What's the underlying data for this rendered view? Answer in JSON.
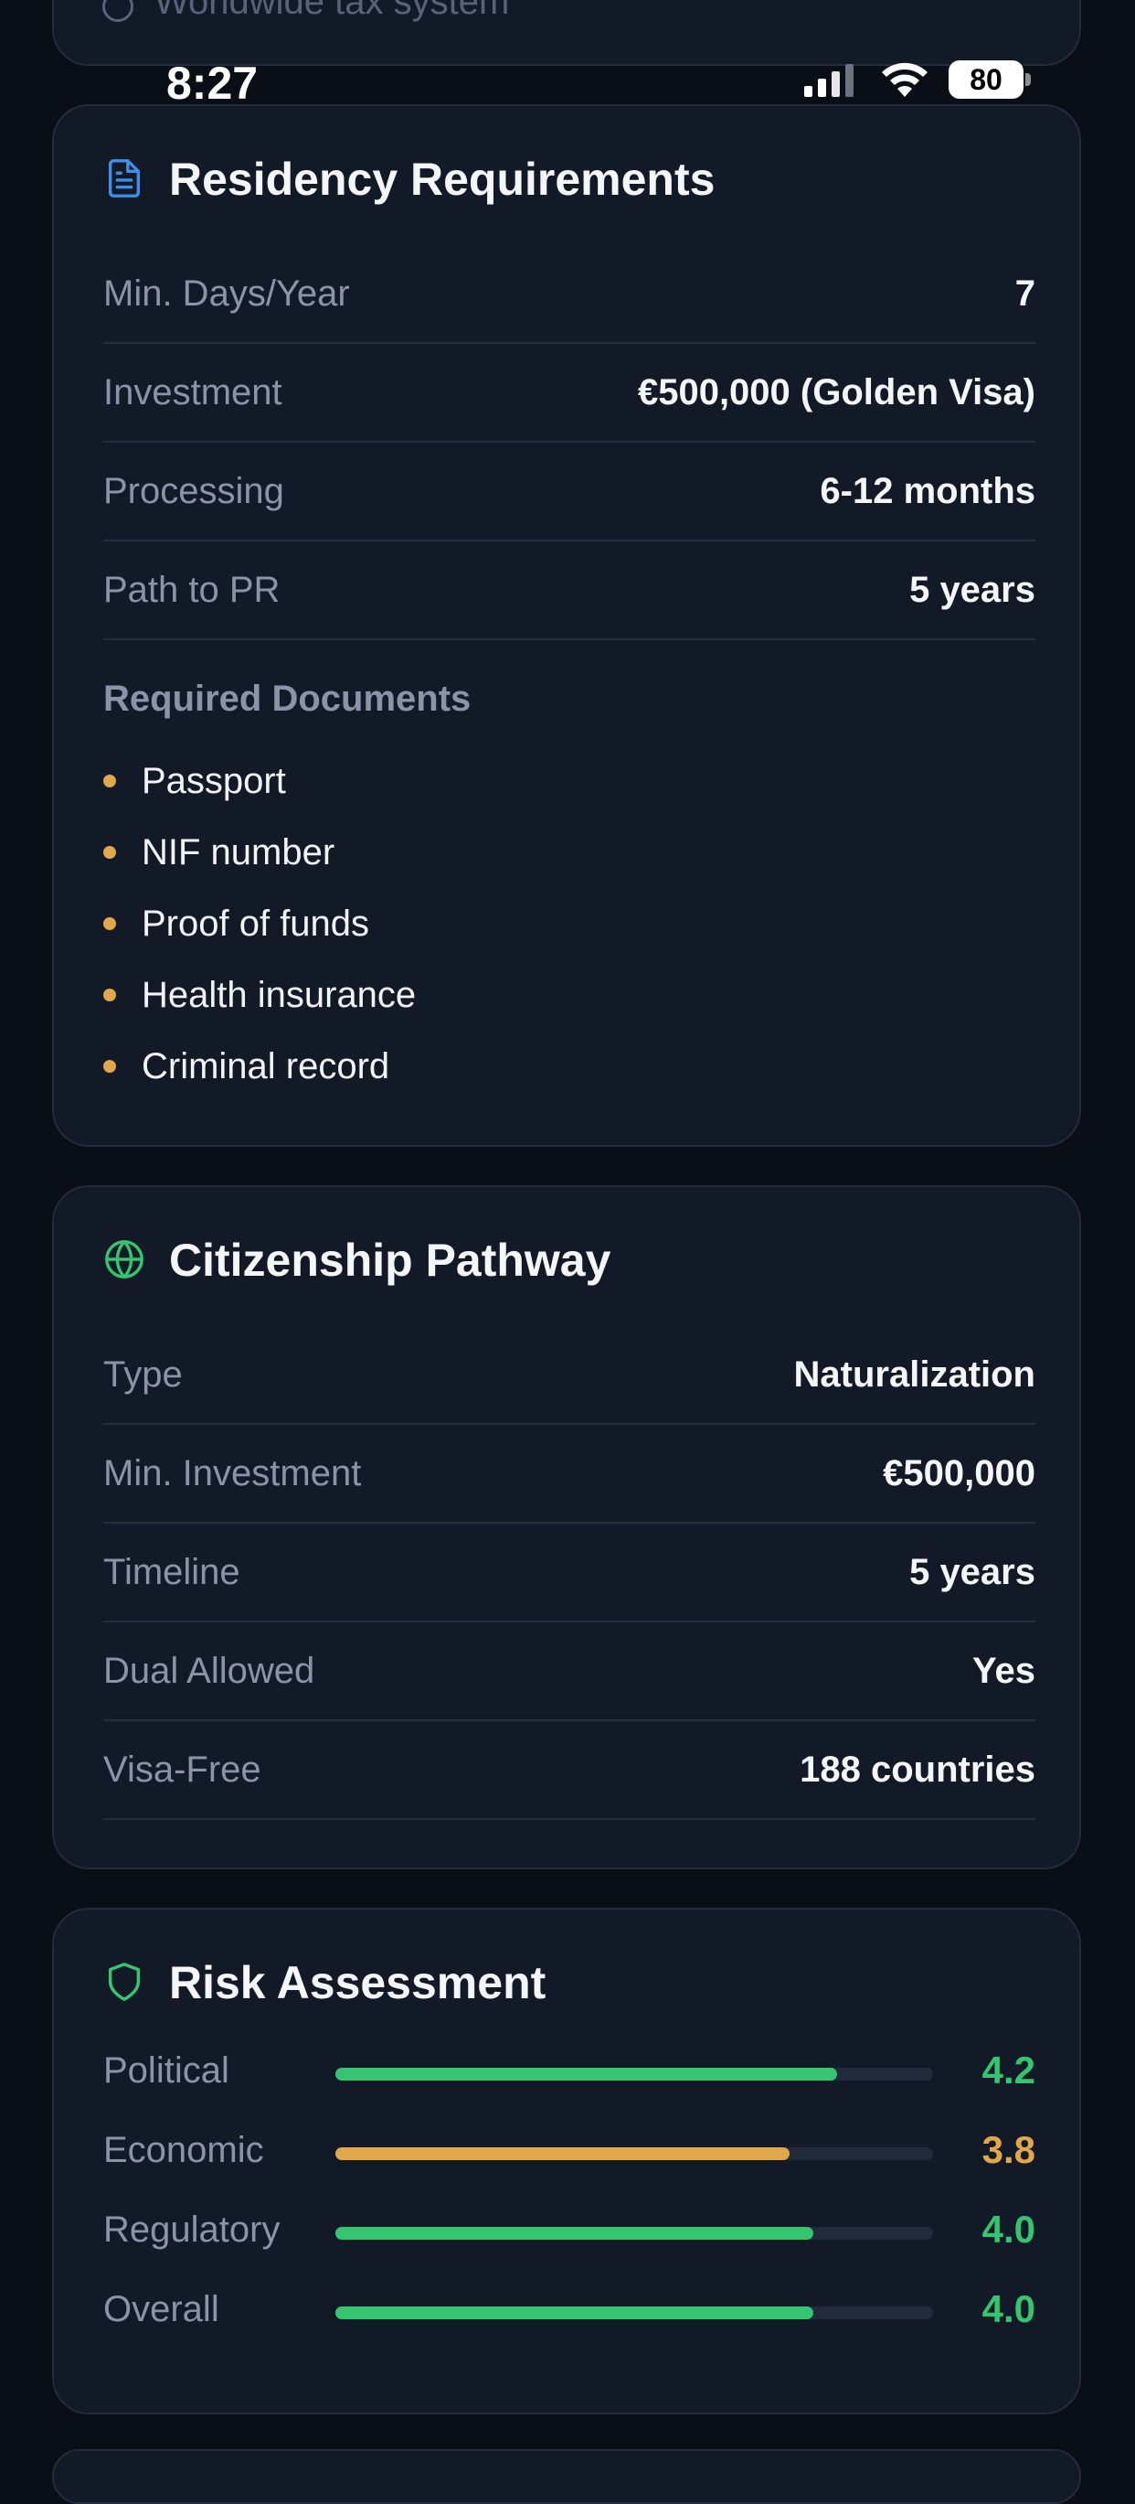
{
  "status_bar": {
    "time": "8:27",
    "battery": "80"
  },
  "previous_card": {
    "partial_text": "Worldwide tax system"
  },
  "residency": {
    "title": "Residency Requirements",
    "rows": [
      {
        "label": "Min. Days/Year",
        "value": "7"
      },
      {
        "label": "Investment",
        "value": "€500,000 (Golden Visa)"
      },
      {
        "label": "Processing",
        "value": "6-12 months"
      },
      {
        "label": "Path to PR",
        "value": "5 years"
      }
    ],
    "docs_heading": "Required Documents",
    "documents": [
      "Passport",
      "NIF number",
      "Proof of funds",
      "Health insurance",
      "Criminal record"
    ]
  },
  "citizenship": {
    "title": "Citizenship Pathway",
    "rows": [
      {
        "label": "Type",
        "value": "Naturalization"
      },
      {
        "label": "Min. Investment",
        "value": "€500,000"
      },
      {
        "label": "Timeline",
        "value": "5 years"
      },
      {
        "label": "Dual Allowed",
        "value": "Yes"
      },
      {
        "label": "Visa-Free",
        "value": "188 countries"
      }
    ]
  },
  "risk": {
    "title": "Risk Assessment",
    "scale_max": 5,
    "items": [
      {
        "label": "Political",
        "score": "4.2",
        "value": 4.2,
        "color": "#35c46f"
      },
      {
        "label": "Economic",
        "score": "3.8",
        "value": 3.8,
        "color": "#e0a84a"
      },
      {
        "label": "Regulatory",
        "score": "4.0",
        "value": 4.0,
        "color": "#35c46f"
      },
      {
        "label": "Overall",
        "score": "4.0",
        "value": 4.0,
        "color": "#35c46f"
      }
    ]
  },
  "colors": {
    "accent_blue": "#3f8fe8",
    "accent_green": "#35c46f",
    "accent_amber": "#e0a84a"
  }
}
